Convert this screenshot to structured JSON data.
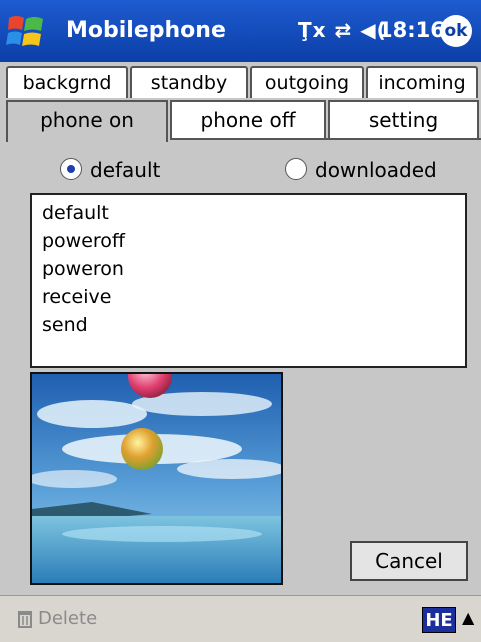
{
  "titlebar": {
    "title": "Mobilephone",
    "status_icons": "Ţx ⇄ ◀(",
    "time": "18:16",
    "ok_label": "ok"
  },
  "tabs_row1": [
    {
      "label": "backgrnd"
    },
    {
      "label": "standby"
    },
    {
      "label": "outgoing"
    },
    {
      "label": "incoming"
    }
  ],
  "tabs_row2": [
    {
      "label": "phone on",
      "active": true
    },
    {
      "label": "phone off",
      "active": false
    },
    {
      "label": "setting",
      "active": false
    }
  ],
  "radios": [
    {
      "label": "default",
      "selected": true
    },
    {
      "label": "downloaded",
      "selected": false
    }
  ],
  "sound_list": [
    "default",
    "poweroff",
    "poweron",
    "receive",
    "send"
  ],
  "cancel_label": "Cancel",
  "bottombar": {
    "delete_label": "Delete",
    "input_mode": "HE",
    "keyboard_toggle": "▲"
  }
}
